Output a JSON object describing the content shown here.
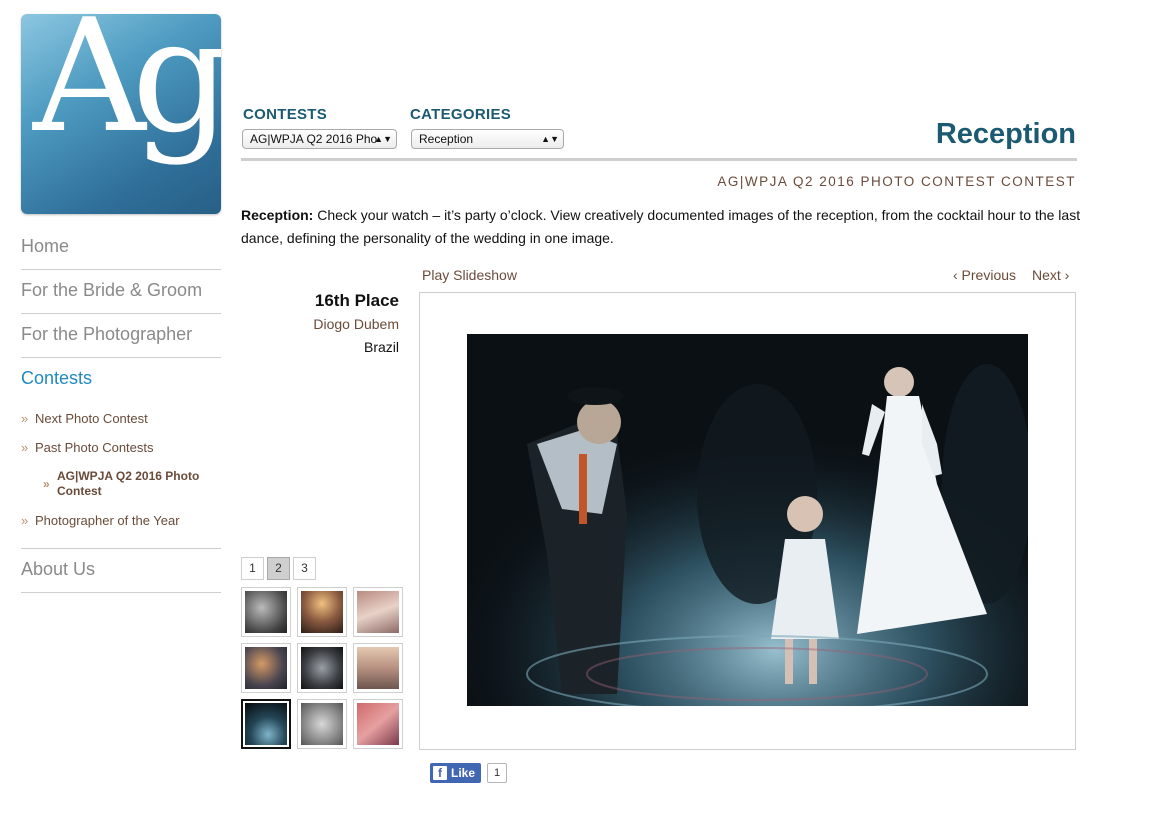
{
  "logo": {
    "text": "Ag"
  },
  "nav": {
    "home": "Home",
    "bride_groom": "For the Bride & Groom",
    "photographer": "For the Photographer",
    "contests": "Contests",
    "sub": {
      "next": "Next Photo Contest",
      "past": "Past Photo Contests",
      "current": "AG|WPJA Q2 2016 Photo Contest",
      "poy": "Photographer of the Year"
    },
    "about": "About Us",
    "bullet": "»"
  },
  "header": {
    "contests_label": "CONTESTS",
    "contests_value": "AG|WPJA Q2 2016 Pho",
    "categories_label": "CATEGORIES",
    "categories_value": "Reception",
    "title": "Reception",
    "contest_name": "AG|WPJA Q2 2016 PHOTO CONTEST CONTEST"
  },
  "description": {
    "label": "Reception:",
    "text": " Check your watch – it’s party o’clock. View creatively documented images of the reception, from the cocktail hour to the last dance, defining the personality of the wedding in one image."
  },
  "controls": {
    "slideshow": "Play Slideshow",
    "previous": "‹ Previous",
    "next": "Next ›"
  },
  "entry": {
    "place": "16th Place",
    "photographer": "Diogo Dubem",
    "country": "Brazil"
  },
  "pager": {
    "pages": [
      "1",
      "2",
      "3"
    ],
    "current": "2"
  },
  "social": {
    "like_label": "Like",
    "like_count": "1",
    "fb_icon": "f"
  },
  "colors": {
    "accent": "#1c5a72",
    "link": "#6a4b3a",
    "active_nav": "#1f8ac0",
    "facebook": "#4267b2"
  }
}
